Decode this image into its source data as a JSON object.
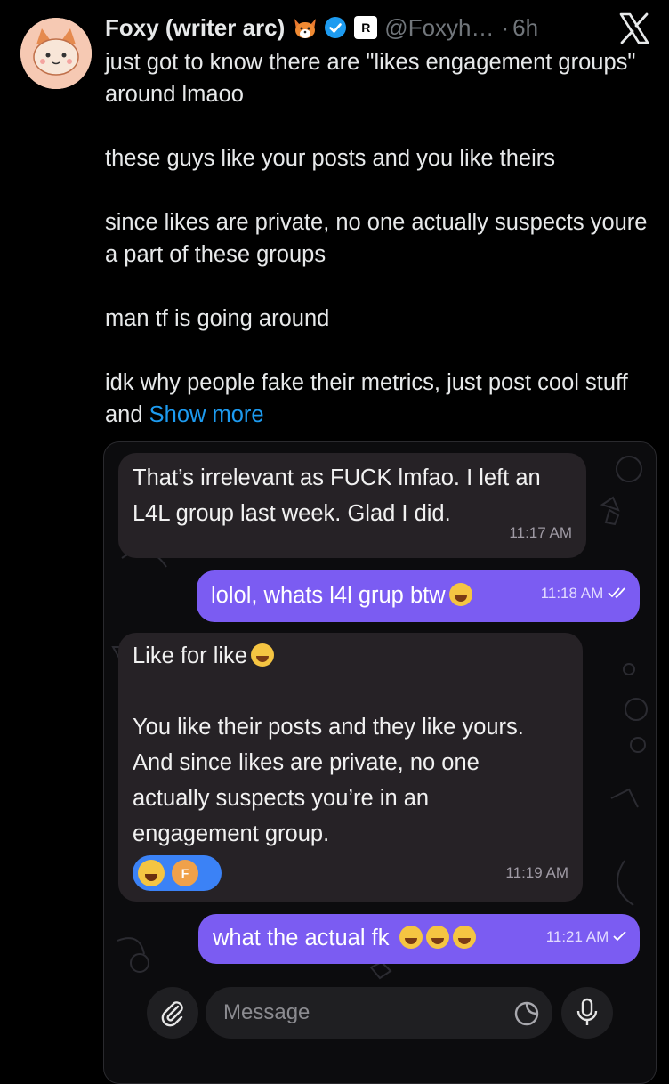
{
  "post": {
    "display_name": "Foxy (writer arc)",
    "affiliate_badge": "R",
    "handle": "@Foxyh…",
    "separator": "·",
    "time": "6h",
    "paragraphs": [
      "just got to know there are \"likes engagement groups\" around lmaoo",
      "these guys like your posts and you like theirs",
      "since likes are private, no one actually suspects youre a part of these groups",
      "man tf is going around",
      "idk why people fake their metrics, just post cool stuff and"
    ],
    "show_more": "Show more"
  },
  "chat": {
    "messages": [
      {
        "text": "That’s irrelevant as FUCK lmfao. I left an L4L group last week. Glad I did.",
        "time": "11:17 AM"
      },
      {
        "text": "lolol, whats l4l grup btw",
        "time": "11:18 AM"
      },
      {
        "text_line1": "Like for like",
        "text_body": "You like their posts and they like yours. And since likes are private, no one actually suspects you’re in an engagement group.",
        "reaction_avatar": "F",
        "time": "11:19 AM"
      },
      {
        "text": "what the actual fk",
        "time": "11:21 AM"
      }
    ],
    "input_placeholder": "Message"
  },
  "colors": {
    "outgoing_bubble": "#7b5cf2",
    "incoming_bubble": "#262226",
    "link": "#1d9bf0",
    "verified": "#1d9bf0"
  },
  "icons": [
    "fox-emoji-icon",
    "verified-badge-icon",
    "affiliate-badge-icon",
    "x-logo-icon",
    "attach-icon",
    "sticker-icon",
    "mic-icon",
    "read-check-icon"
  ]
}
